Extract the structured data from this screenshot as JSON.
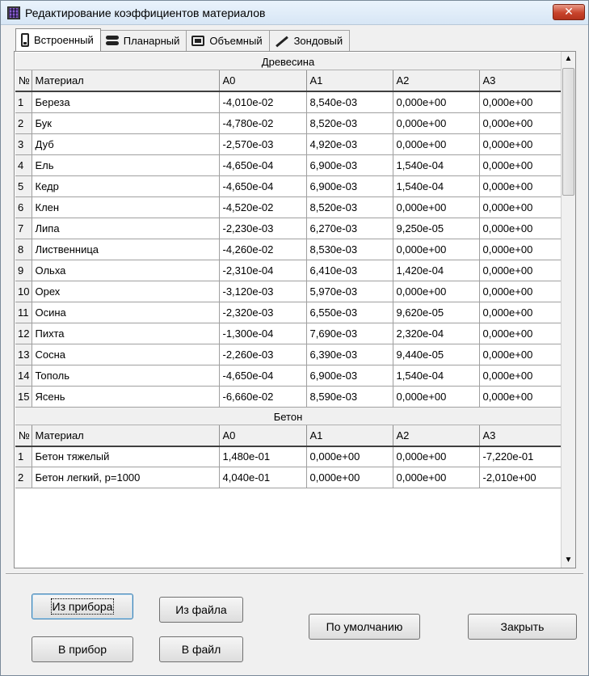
{
  "window": {
    "title": "Редактирование коэффициентов материалов",
    "close_label": "✕"
  },
  "tabs": [
    {
      "label": "Встроенный",
      "icon": "device-icon",
      "active": true
    },
    {
      "label": "Планарный",
      "icon": "stack-icon",
      "active": false
    },
    {
      "label": "Объемный",
      "icon": "volume-icon",
      "active": false
    },
    {
      "label": "Зондовый",
      "icon": "probe-icon",
      "active": false
    }
  ],
  "columns": [
    "№",
    "Материал",
    "A0",
    "A1",
    "A2",
    "A3"
  ],
  "sections": [
    {
      "name": "Древесина",
      "rows": [
        [
          "1",
          "Береза",
          "-4,010e-02",
          "8,540e-03",
          "0,000e+00",
          "0,000e+00"
        ],
        [
          "2",
          "Бук",
          "-4,780e-02",
          "8,520e-03",
          "0,000e+00",
          "0,000e+00"
        ],
        [
          "3",
          "Дуб",
          "-2,570e-03",
          "4,920e-03",
          "0,000e+00",
          "0,000e+00"
        ],
        [
          "4",
          "Ель",
          "-4,650e-04",
          "6,900e-03",
          "1,540e-04",
          "0,000e+00"
        ],
        [
          "5",
          "Кедр",
          "-4,650e-04",
          "6,900e-03",
          "1,540e-04",
          "0,000e+00"
        ],
        [
          "6",
          "Клен",
          "-4,520e-02",
          "8,520e-03",
          "0,000e+00",
          "0,000e+00"
        ],
        [
          "7",
          "Липа",
          "-2,230e-03",
          "6,270e-03",
          "9,250e-05",
          "0,000e+00"
        ],
        [
          "8",
          "Лиственница",
          "-4,260e-02",
          "8,530e-03",
          "0,000e+00",
          "0,000e+00"
        ],
        [
          "9",
          "Ольха",
          "-2,310e-04",
          "6,410e-03",
          "1,420e-04",
          "0,000e+00"
        ],
        [
          "10",
          "Орех",
          "-3,120e-03",
          "5,970e-03",
          "0,000e+00",
          "0,000e+00"
        ],
        [
          "11",
          "Осина",
          "-2,320e-03",
          "6,550e-03",
          "9,620e-05",
          "0,000e+00"
        ],
        [
          "12",
          "Пихта",
          "-1,300e-04",
          "7,690e-03",
          "2,320e-04",
          "0,000e+00"
        ],
        [
          "13",
          "Сосна",
          "-2,260e-03",
          "6,390e-03",
          "9,440e-05",
          "0,000e+00"
        ],
        [
          "14",
          "Тополь",
          "-4,650e-04",
          "6,900e-03",
          "1,540e-04",
          "0,000e+00"
        ],
        [
          "15",
          "Ясень",
          "-6,660e-02",
          "8,590e-03",
          "0,000e+00",
          "0,000e+00"
        ]
      ]
    },
    {
      "name": "Бетон",
      "rows": [
        [
          "1",
          "Бетон тяжелый",
          "1,480e-01",
          "0,000e+00",
          "0,000e+00",
          "-7,220e-01"
        ],
        [
          "2",
          "Бетон легкий, p=1000",
          "4,040e-01",
          "0,000e+00",
          "0,000e+00",
          "-2,010e+00"
        ]
      ]
    }
  ],
  "buttons": {
    "from_device": "Из прибора",
    "to_device": "В прибор",
    "from_file": "Из файла",
    "to_file": "В файл",
    "defaults": "По умолчанию",
    "close": "Закрыть"
  },
  "scrollbar": {
    "up_icon": "▲",
    "down_icon": "▼"
  }
}
